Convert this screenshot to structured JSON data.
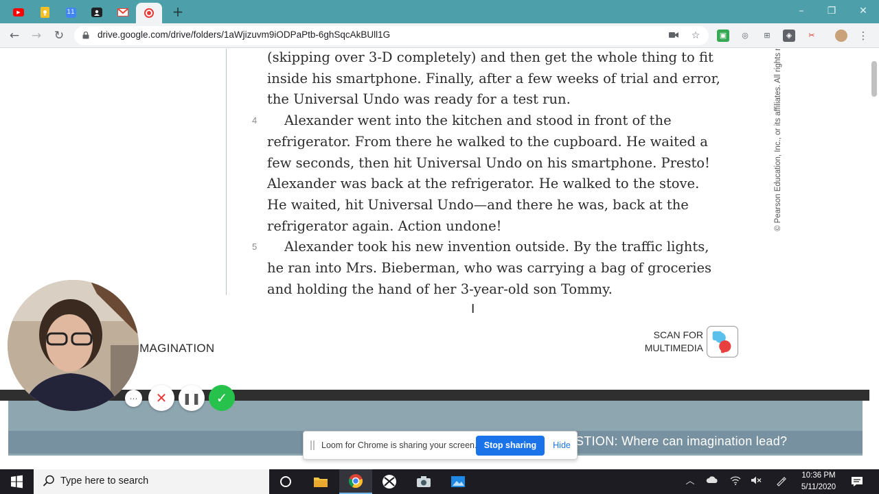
{
  "browser": {
    "tabs": [
      {
        "name": "youtube",
        "color": "#ff0000",
        "glyph": "▶"
      },
      {
        "name": "keep",
        "color": "#f6bf26",
        "glyph": ""
      },
      {
        "name": "calendar",
        "color": "#4285f4",
        "glyph": "11"
      },
      {
        "name": "classroom",
        "color": "#202124",
        "glyph": ""
      },
      {
        "name": "gmail",
        "color": "#ea4335",
        "glyph": "M"
      },
      {
        "name": "recording",
        "color": "#e53935",
        "glyph": "●"
      }
    ],
    "url": "drive.google.com/drive/folders/1aWjizuvm9iODPaPtb-6ghSqcAkBUll1G"
  },
  "document": {
    "paragraphs": [
      {
        "number": "",
        "lines": [
          "(skipping over 3-D completely) and then get the whole thing to fit",
          "inside his smartphone. Finally, after a few weeks of trial and error,",
          "the Universal Undo was ready for a test run."
        ]
      },
      {
        "number": "4",
        "lines": [
          "Alexander went into the kitchen and stood in front of the",
          "refrigerator. From there he walked to the cupboard. He waited a",
          "few seconds, then hit Universal Undo on his smartphone. Presto!",
          "Alexander was back at the refrigerator. He walked to the stove.",
          "He waited, hit Universal Undo—and there he was, back at the",
          "refrigerator again. Action undone!"
        ]
      },
      {
        "number": "5",
        "lines": [
          "Alexander took his new invention outside. By the traffic lights,",
          "he ran into Mrs. Bieberman, who was carrying a bag of groceries",
          "and holding the hand of her 3-year-old son Tommy."
        ]
      }
    ],
    "copyright": "© Pearson Education, Inc., or its affiliates. All rights re",
    "footer_label": "4 • IMAGINATION",
    "scan_label_line1": "SCAN FOR",
    "scan_label_line2": "MULTIMEDIA",
    "next_page_title": "STION: Where can imagination lead?"
  },
  "loom": {
    "message": "Loom for Chrome is sharing your screen.",
    "stop_label": "Stop sharing",
    "hide_label": "Hide"
  },
  "taskbar": {
    "search_placeholder": "Type here to search",
    "time": "10:36 PM",
    "date": "5/11/2020"
  }
}
